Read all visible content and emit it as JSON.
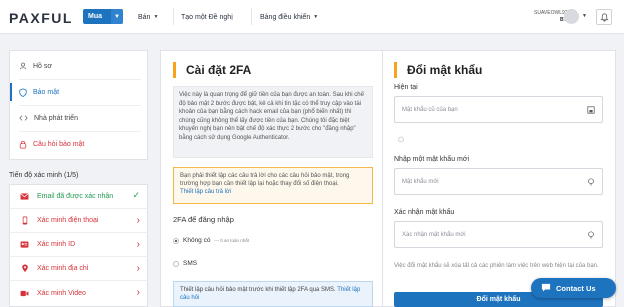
{
  "header": {
    "logo": "PAXFUL",
    "buy_label": "Mua",
    "sell_label": "Bán",
    "create_offer_label": "Tạo một Đề nghị",
    "dashboard_label": "Bảng điều khiển",
    "username": "SUAVEOWL928",
    "balance_unit": "BTC"
  },
  "sidebar": {
    "items": [
      {
        "label": "Hồ sơ",
        "icon": "person-icon"
      },
      {
        "label": "Bảo mật",
        "icon": "shield-icon"
      },
      {
        "label": "Nhà phát triển",
        "icon": "code-icon"
      },
      {
        "label": "Câu hỏi bảo mật",
        "icon": "lock-icon"
      }
    ]
  },
  "verification": {
    "progress_label": "Tiến độ xác minh (1/5)",
    "items": [
      {
        "label": "Email đã được xác nhận",
        "status": "done",
        "icon": "envelope-icon"
      },
      {
        "label": "Xác minh điện thoại",
        "status": "pending",
        "icon": "phone-icon"
      },
      {
        "label": "Xác minh ID",
        "status": "pending",
        "icon": "id-card-icon"
      },
      {
        "label": "Xác minh địa chỉ",
        "status": "pending",
        "icon": "location-icon"
      },
      {
        "label": "Xác minh Video",
        "status": "pending",
        "icon": "video-icon"
      }
    ]
  },
  "twofa": {
    "title": "Cài đặt 2FA",
    "description": "Việc này là quan trọng để giữ tiền của bạn được an toàn. Sau khi chế độ bảo mật 2 bước được bật, kẻ cả khi tin tặc có thể truy cập vào tài khoản của bạn bằng cách hack email của bạn (phổ biến nhất) thì chúng cũng không thể lấy được tiền của bạn. Chúng tôi đặc biệt khuyến nghị bạn nên bật chế độ xác thực 2 bước cho \"đăng nhập\" bằng cách sử dụng Google Authenticator.",
    "warning_text": "Bạn phải thiết lập các câu trả lời cho các câu hỏi bảo mật, trong trường hợp bạn cần thiết lập lại hoặc thay đổi số điện thoại.",
    "warning_link": "Thiết lập câu trả lời",
    "login_section_title": "2FA để đăng nhập",
    "option_none": "Không có",
    "option_none_sub": "— Ít an toàn nhất",
    "option_sms": "SMS",
    "info_text": "Thiết lập câu hỏi bảo mật trước khi thiết lập 2FA qua SMS.",
    "info_link": "Thiết lập câu hỏi"
  },
  "password": {
    "title": "Đổi mật khẩu",
    "current_label": "Hiện tại",
    "current_placeholder": "Mật khẩu cũ của bạn",
    "new_label": "Nhập một mật khẩu mới",
    "new_placeholder": "Mật khẩu mới",
    "confirm_label": "Xác nhận mật khẩu",
    "confirm_placeholder": "Xác nhận mật khẩu mới",
    "hint": "Việc đổi mật khẩu sẽ xóa tất cả các phiên làm việc trên web hiện tại của bạn.",
    "submit_label": "Đổi mật khẩu"
  },
  "contact": {
    "label": "Contact Us"
  },
  "colors": {
    "accent": "#1e73be",
    "warning": "#f6a21a",
    "danger": "#d6333b",
    "success": "#239a52"
  }
}
